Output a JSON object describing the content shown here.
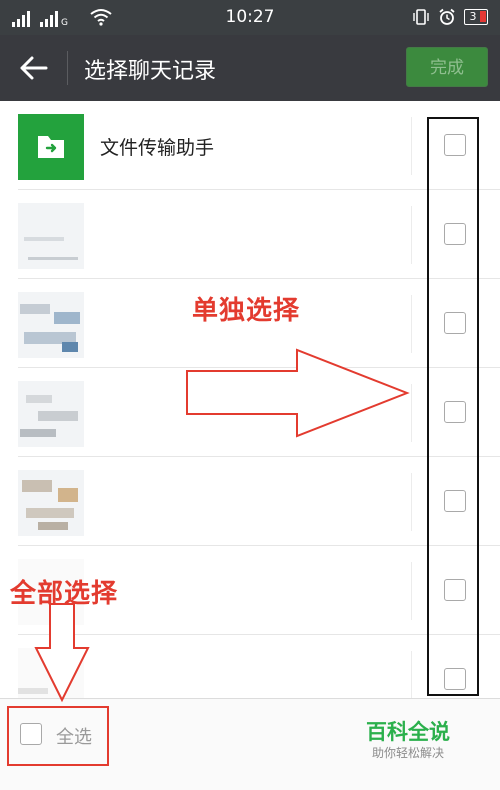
{
  "status_bar": {
    "time": "10:27",
    "battery": "3",
    "network_type": "G",
    "icons": [
      "signal-icon",
      "signal-icon",
      "wifi-icon",
      "vibrate-icon",
      "alarm-icon",
      "battery-icon"
    ]
  },
  "header": {
    "title": "选择聊天记录",
    "done_label": "完成",
    "back_icon": "arrow-left-icon"
  },
  "chats": [
    {
      "name": "文件传输助手",
      "avatar": "folder-arrow-icon",
      "avatar_color": "#23a23d",
      "selected": false
    },
    {
      "name": "",
      "avatar": "redacted",
      "selected": false
    },
    {
      "name": "",
      "avatar": "redacted",
      "selected": false
    },
    {
      "name": "",
      "avatar": "redacted",
      "selected": false
    },
    {
      "name": "",
      "avatar": "redacted",
      "selected": false
    },
    {
      "name": "",
      "avatar": "redacted",
      "selected": false
    },
    {
      "name": "",
      "avatar": "redacted",
      "selected": false
    }
  ],
  "footer": {
    "select_all_label": "全选",
    "select_all_checked": false
  },
  "annotations": {
    "single_select": "单独选择",
    "select_all": "全部选择",
    "color": "#e33b2f"
  },
  "watermark": {
    "brand": "百科全说",
    "tagline": "助你轻松解决",
    "color": "#2bb04c"
  },
  "colors": {
    "title_bar": "#393a3f",
    "status_bar": "#3b3f42",
    "done_button": "#3c8a3e"
  }
}
